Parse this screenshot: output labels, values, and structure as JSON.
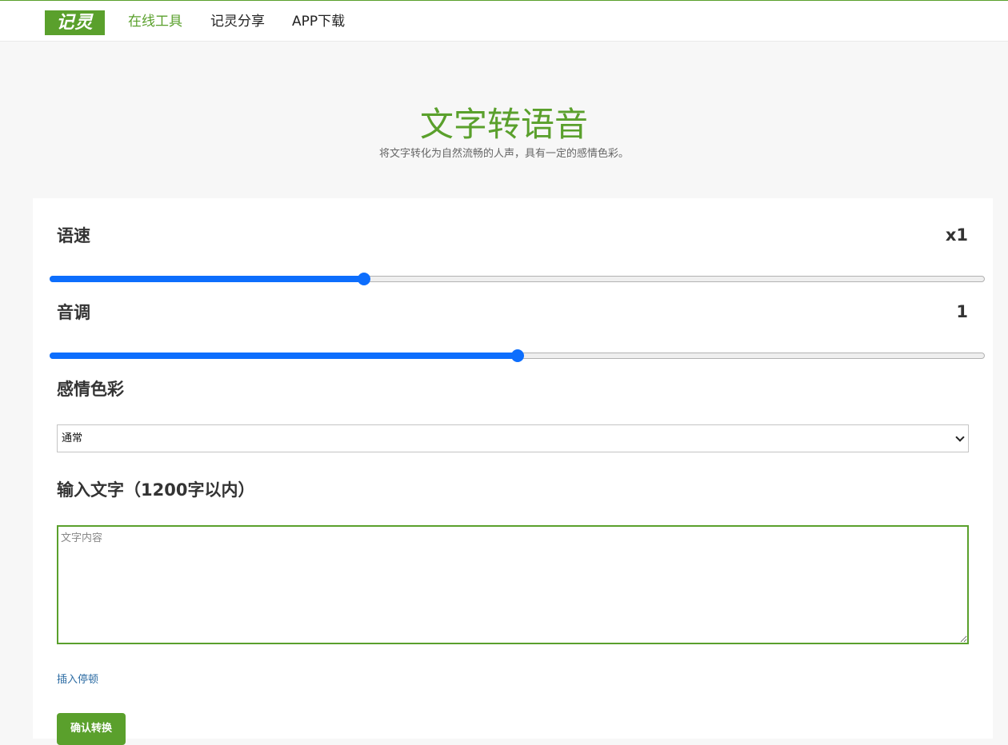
{
  "nav": {
    "logo": "记灵",
    "links": [
      "在线工具",
      "记灵分享",
      "APP下载"
    ],
    "active_index": 0
  },
  "colors": {
    "brand": "#5aa02c",
    "slider_accent": "#0d6efd",
    "link": "#2e6da4"
  },
  "header": {
    "title": "文字转语音",
    "subtitle": "将文字转化为自然流畅的人声，具有一定的感情色彩。"
  },
  "form": {
    "speed": {
      "label": "语速",
      "value_text": "x1",
      "level": 0.336
    },
    "pitch": {
      "label": "音调",
      "value_text": "1",
      "level": 0.5
    },
    "emotion": {
      "label": "感情色彩",
      "selected": "通常"
    },
    "text_input": {
      "label": "输入文字（1200字以内）",
      "placeholder": "文字内容",
      "value": ""
    },
    "insert_pause": "插入停顿",
    "confirm": "确认转换"
  }
}
